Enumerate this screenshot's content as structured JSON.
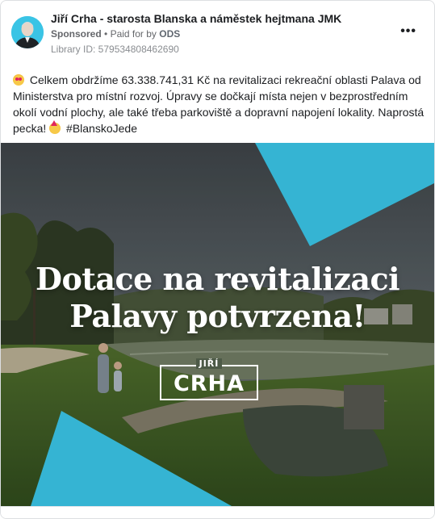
{
  "ad": {
    "advertiser_name": "Jiří Crha - starosta Blanska a náměstek hejtmana JMK",
    "sponsored_label": "Sponsored",
    "separator": "•",
    "paid_for_prefix": "Paid for by",
    "paid_for_by": "ODS",
    "library_id": "Library ID: 579534808462690",
    "more_label": "•••",
    "body_text": "Celkem obdržíme 63.338.741,31 Kč na revitalizaci rekreační oblasti Palava od Ministerstva pro místní rozvoj. Úpravy se dočkají místa nejen v bezprostředním okolí vodní plochy, ale také třeba parkoviště a dopravní napojení lokality. Naprostá pecka!",
    "hashtag": "#BlanskoJede",
    "icons": [
      "heart-eyes-emoji-icon",
      "party-face-emoji-icon",
      "more-options-icon"
    ]
  },
  "creative": {
    "headline_line1": "Dotace na revitalizaci",
    "headline_line2": "Palavy potvrzena!",
    "logo_small": "JIŘÍ",
    "logo_big": "CRHA",
    "accent_color": "#3ac4e5"
  }
}
